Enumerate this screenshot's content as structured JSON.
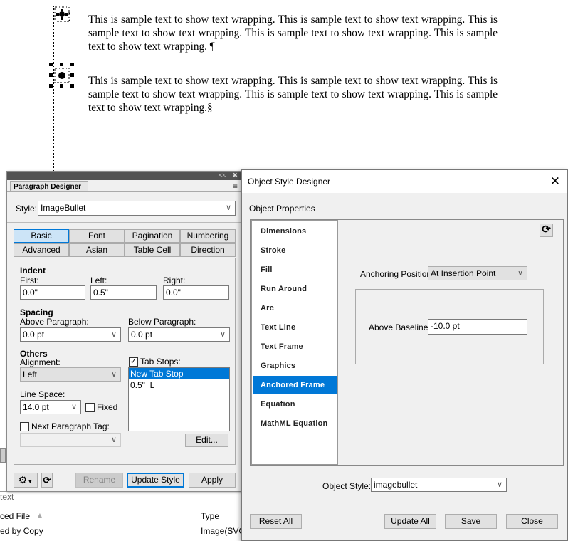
{
  "document": {
    "paragraphs": [
      "This is sample text to show text wrapping. This is sample text to show text wrapping. This is sample text to show text wrapping. This is sample text to show text wrapping. This is sam­ple text to show text wrapping. ¶",
      "This is sample text to show text wrapping. This is sample text to show text wrapping. This is sample text to show text wrapping. This is sample text to show text wrapping. This is sam­ple text to show text wrapping.§"
    ]
  },
  "paragraph_designer": {
    "panel_tab": "Paragraph Designer",
    "collapse": "<<",
    "close": "✖",
    "style_label": "Style:",
    "style_value": "ImageBullet",
    "tabs": [
      "Basic",
      "Font",
      "Pagination",
      "Numbering",
      "Advanced",
      "Asian",
      "Table Cell",
      "Direction"
    ],
    "selected_tab": "Basic",
    "indent": {
      "heading": "Indent",
      "first_label": "First:",
      "first": "0.0\"",
      "left_label": "Left:",
      "left": "0.5\"",
      "right_label": "Right:",
      "right": "0.0\""
    },
    "spacing": {
      "heading": "Spacing",
      "above_label": "Above Paragraph:",
      "above": "0.0 pt",
      "below_label": "Below Paragraph:",
      "below": "0.0 pt"
    },
    "others": {
      "heading": "Others",
      "alignment_label": "Alignment:",
      "alignment": "Left",
      "line_space_label": "Line Space:",
      "line_space": "14.0 pt",
      "fixed_label": "Fixed",
      "fixed": false,
      "next_tag_label": "Next Paragraph Tag:",
      "next_tag": false
    },
    "tab_stops": {
      "label": "Tab Stops:",
      "checked": true,
      "items": [
        "New Tab Stop",
        "0.5\"  L"
      ],
      "selected": "New Tab Stop",
      "edit": "Edit..."
    },
    "buttons": {
      "rename": "Rename",
      "update_style": "Update Style",
      "apply": "Apply"
    }
  },
  "object_style_designer": {
    "title": "Object Style Designer",
    "section": "Object Properties",
    "properties": [
      "Dimensions",
      "Stroke",
      "Fill",
      "Run Around",
      "Arc",
      "Text Line",
      "Text Frame",
      "Graphics",
      "Anchored Frame",
      "Equation",
      "MathML Equation"
    ],
    "selected": "Anchored Frame",
    "anchoring_label": "Anchoring Position:",
    "anchoring_value": "At Insertion Point",
    "baseline_label": "Above Baseline:",
    "baseline_value": "-10.0 pt",
    "object_style_label": "Object Style:",
    "object_style_value": "imagebullet",
    "buttons": {
      "reset_all": "Reset All",
      "update_all": "Update All",
      "save": "Save",
      "close": "Close"
    }
  },
  "background_list": {
    "label": "text",
    "col1": "ced File",
    "col2": "Type",
    "row1": [
      "ed by Copy",
      "Image(SVG)"
    ]
  },
  "colors": {
    "accent": "#0078d7",
    "selected_tab": "#cce4f7",
    "panel_bg": "#f0f0f0"
  }
}
